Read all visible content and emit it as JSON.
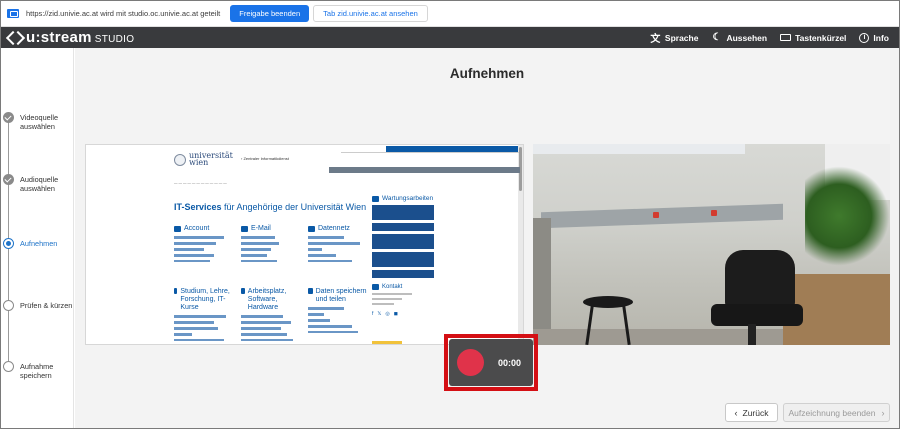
{
  "share_bar": {
    "message": "https://zid.univie.ac.at wird mit studio.oc.univie.ac.at geteilt",
    "stop_label": "Freigabe beenden",
    "view_tab_label": "Tab zid.univie.ac.at ansehen"
  },
  "app": {
    "logo_text": "u:stream",
    "logo_suffix": "STUDIO",
    "nav": [
      {
        "label": "Sprache",
        "icon": "translate-icon"
      },
      {
        "label": "Aussehen",
        "icon": "moon-icon"
      },
      {
        "label": "Tastenkürzel",
        "icon": "keyboard-icon"
      },
      {
        "label": "Info",
        "icon": "info-icon"
      }
    ]
  },
  "steps": [
    {
      "label": "Videoquelle auswählen",
      "state": "done"
    },
    {
      "label": "Audioquelle auswählen",
      "state": "done"
    },
    {
      "label": "Aufnehmen",
      "state": "active"
    },
    {
      "label": "Prüfen & kürzen",
      "state": "pending"
    },
    {
      "label": "Aufnahme speichern",
      "state": "pending"
    }
  ],
  "main": {
    "title": "Aufnehmen"
  },
  "screen_preview": {
    "university_name": "universität wien",
    "page_heading_bold": "IT-Services",
    "page_heading_rest": " für Angehörige der Universität Wien",
    "top_link": "Zentraler Informatikdienst",
    "sections": [
      "Account",
      "E-Mail",
      "Datennetz",
      "Studium, Lehre, Forschung, IT-Kurse",
      "Arbeitsplatz, Software, Hardware",
      "Daten speichern und teilen"
    ],
    "aside_heading": "Wartungsarbeiten",
    "kontakt_heading": "Kontakt"
  },
  "recording": {
    "time": "00:00",
    "highlight_color": "#d40f14",
    "button_color": "#e0334a"
  },
  "footer": {
    "back_label": "Zurück",
    "end_label": "Aufzeichnung beenden"
  }
}
